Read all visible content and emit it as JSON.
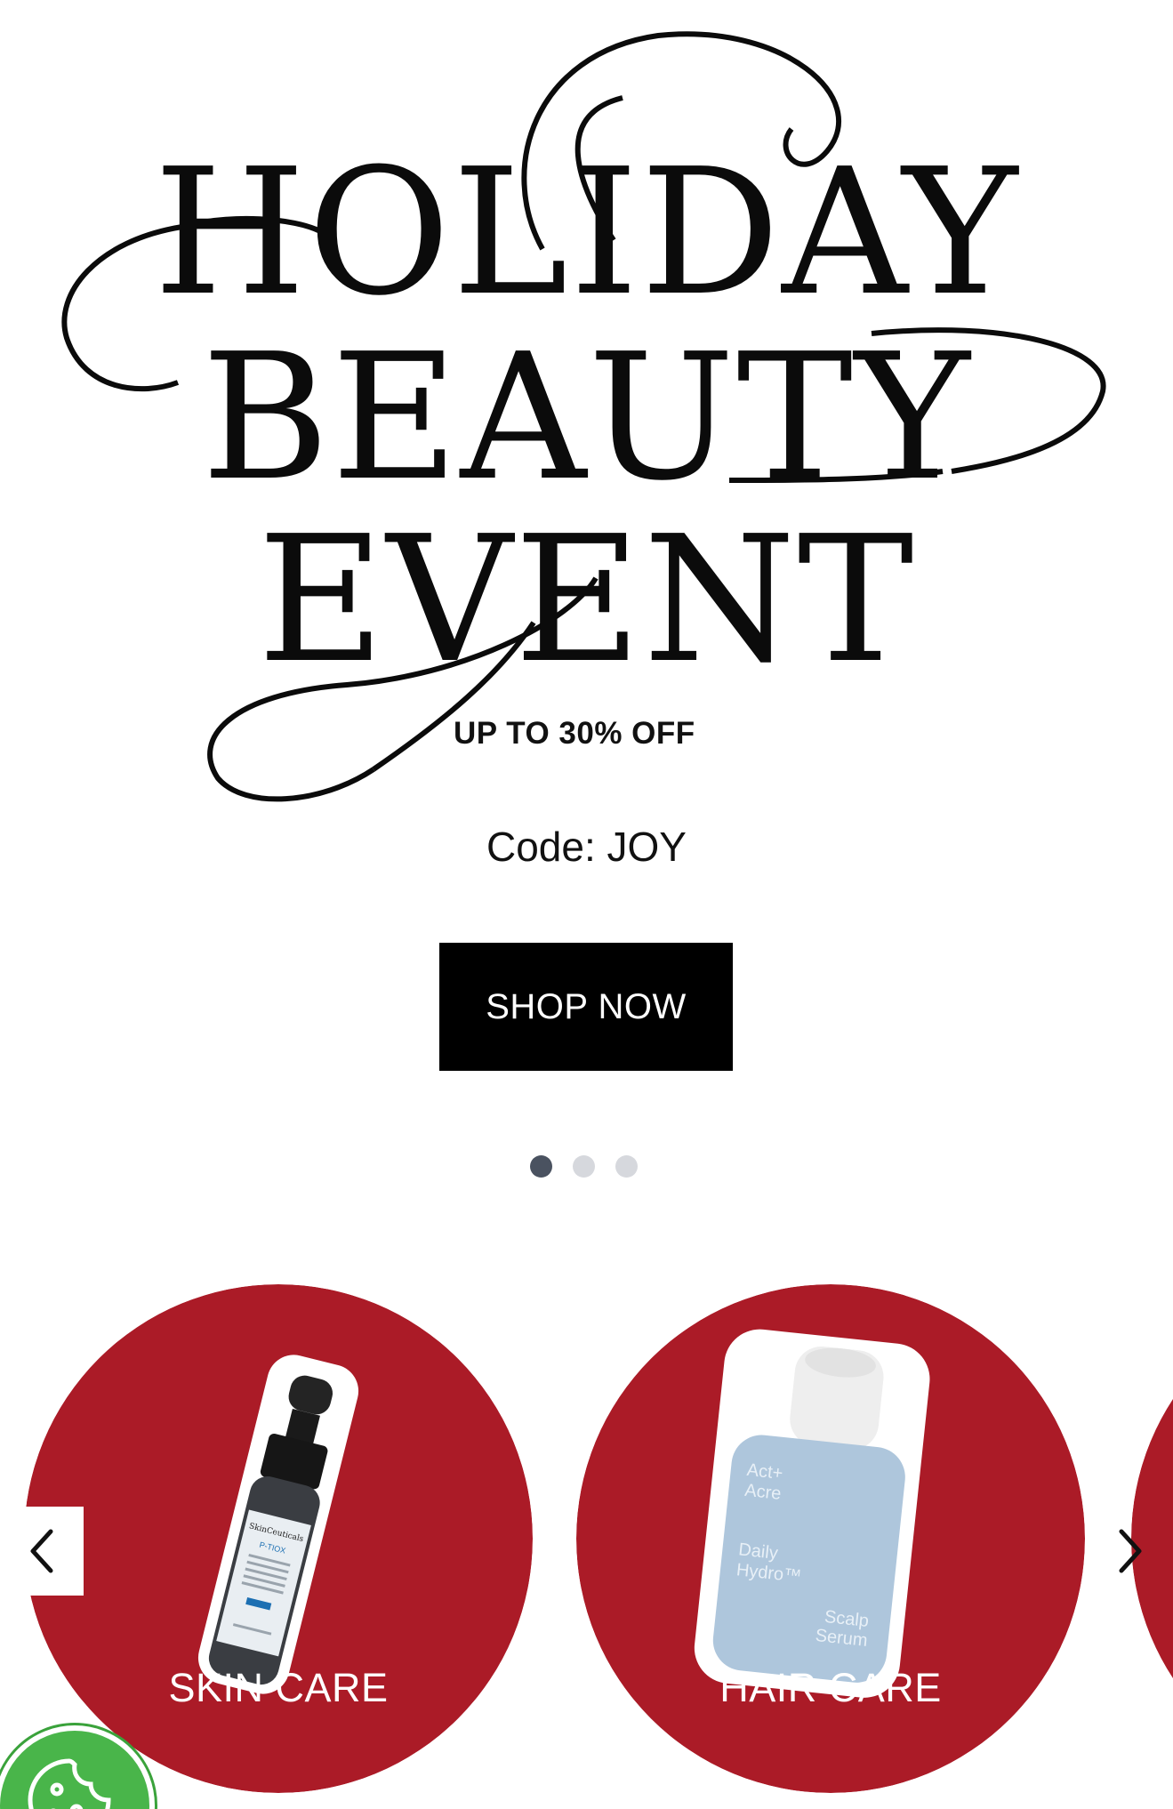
{
  "hero": {
    "title_line1": "HOLIDAY",
    "title_line2": "BEAUTY",
    "title_line3": "EVENT",
    "promo": "UP TO 30% OFF",
    "code": "Code: JOY",
    "cta": "SHOP NOW"
  },
  "carousel": {
    "slide_count": 3,
    "active_slide": 1
  },
  "categories": [
    {
      "label": "SKIN CARE",
      "product_text": [
        "SkinCeuticals",
        "P-TIOX"
      ]
    },
    {
      "label": "HAIR CARE",
      "product_text": [
        "Act+",
        "Acre",
        "Daily",
        "Hydro™",
        "Scalp",
        "Serum"
      ]
    }
  ],
  "colors": {
    "brand_red": "#ab1b27",
    "cta_bg": "#000000",
    "dot_active": "#4a5260",
    "dot_inactive": "#d6d8dd",
    "cookie_green": "#49b54a"
  },
  "icons": {
    "prev": "chevron-left-icon",
    "next": "chevron-right-icon",
    "cookie": "cookie-icon"
  }
}
